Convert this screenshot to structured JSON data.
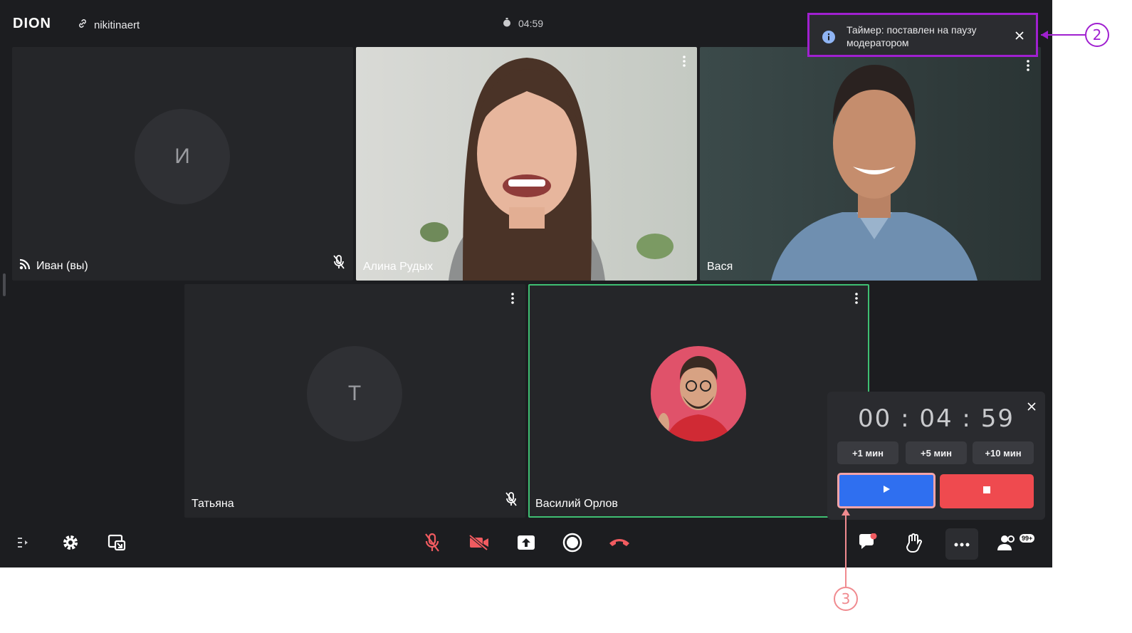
{
  "app": {
    "logo": "DION",
    "room_name": "nikitinaert",
    "timer": "04:59"
  },
  "tiles": [
    {
      "name": "Иван (вы)",
      "initial": "И"
    },
    {
      "name": "Алина Рудых"
    },
    {
      "name": "Вася"
    },
    {
      "name": "Татьяна",
      "initial": "Т"
    },
    {
      "name": "Василий Орлов"
    }
  ],
  "toast": {
    "message": "Таймер: поставлен на паузу модератором"
  },
  "timer_panel": {
    "display": "00 : 04 : 59",
    "add_buttons": [
      "+1 мин",
      "+5 мин",
      "+10 мин"
    ]
  },
  "toolbar": {
    "participants_badge": "99+"
  },
  "callouts": [
    "2",
    "3"
  ],
  "colors": {
    "accent_blue": "#2f6ff0",
    "danger_red": "#ef4a4f",
    "speaker_green": "#3fbf72",
    "callout_purple": "#a020d0",
    "callout_pink": "#f08a8f"
  }
}
